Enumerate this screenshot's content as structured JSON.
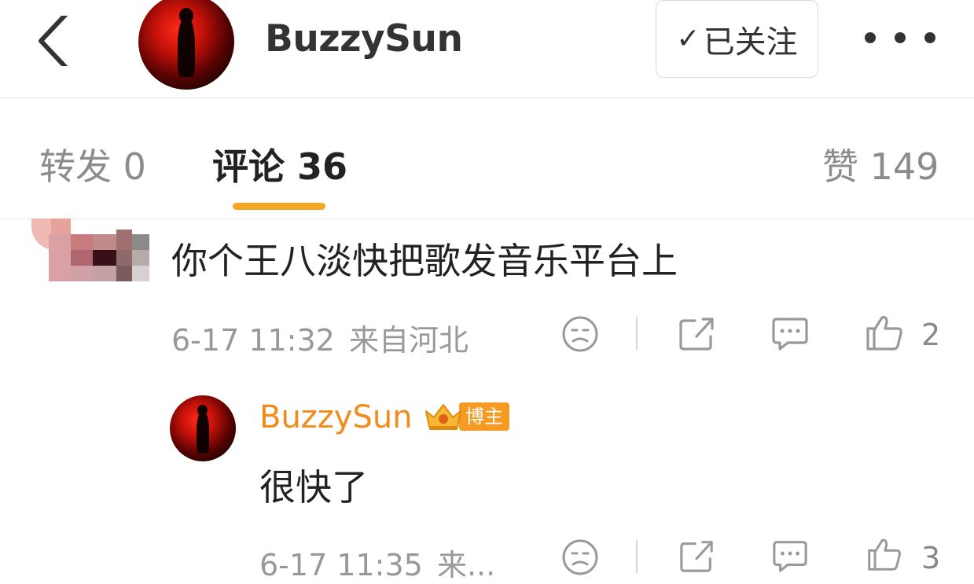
{
  "header": {
    "title": "BuzzySun",
    "follow_label": "已关注",
    "follow_check": "✓"
  },
  "tabs": [
    {
      "label": "转发 0"
    },
    {
      "label": "评论 36"
    },
    {
      "label": "赞 149"
    }
  ],
  "comments": [
    {
      "text": "你个王八淡快把歌发音乐平台上",
      "time": "6-17 11:32",
      "location": "来自河北",
      "likes": "2"
    }
  ],
  "reply": {
    "author": "BuzzySun",
    "badge": "博主",
    "text": "很快了",
    "time": "6-17 11:35",
    "location": "来...",
    "likes": "3"
  },
  "colors": {
    "accent": "#f5a623",
    "reply_name": "#f28a1c"
  }
}
